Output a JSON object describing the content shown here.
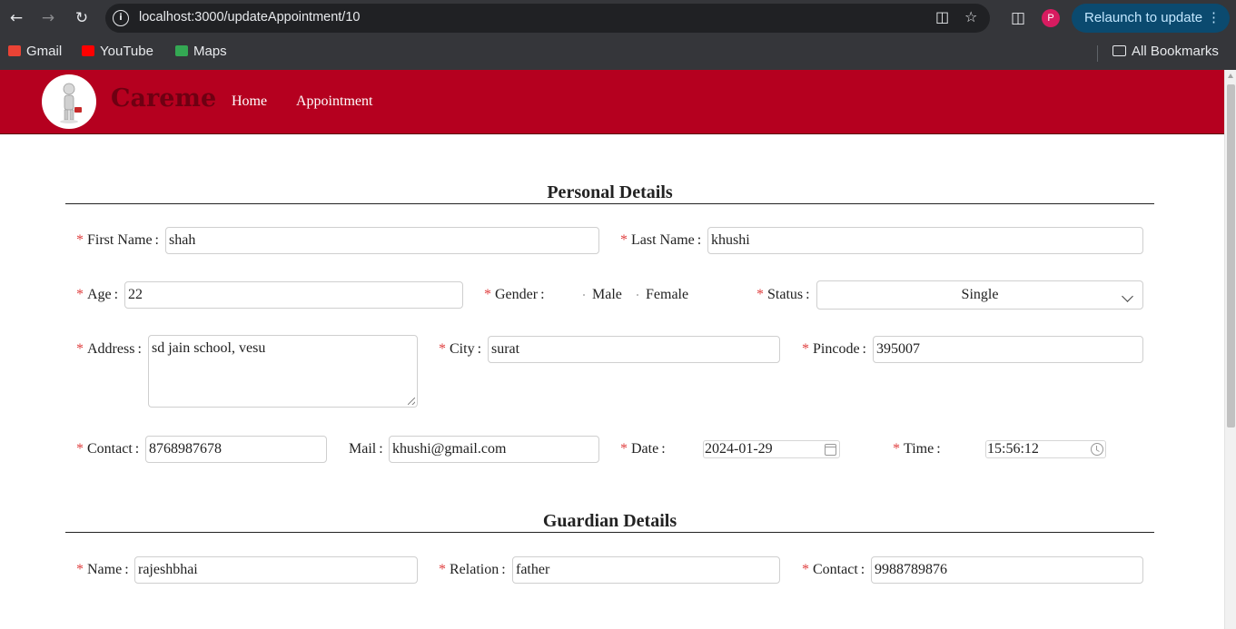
{
  "browser": {
    "url": "localhost:3000/updateAppointment/10",
    "relaunch_label": "Relaunch to update",
    "profile_initial": "P",
    "bookmarks": [
      {
        "label": "Gmail",
        "icon": "gmail-icon",
        "color": "#ea4335"
      },
      {
        "label": "YouTube",
        "icon": "youtube-icon",
        "color": "#ff0000"
      },
      {
        "label": "Maps",
        "icon": "maps-icon",
        "color": "#34a853"
      }
    ],
    "all_bookmarks_label": "All Bookmarks"
  },
  "header": {
    "brand": "Careme",
    "nav": [
      "Home",
      "Appointment"
    ],
    "background_color": "#b5001f"
  },
  "personal": {
    "title": "Personal Details",
    "first_name": {
      "label": "First Name",
      "value": "shah"
    },
    "last_name": {
      "label": "Last Name",
      "value": "khushi"
    },
    "age": {
      "label": "Age",
      "value": "22"
    },
    "gender": {
      "label": "Gender",
      "options": [
        "Male",
        "Female"
      ]
    },
    "status": {
      "label": "Status",
      "value": "Single"
    },
    "address": {
      "label": "Address",
      "value": "sd jain school, vesu"
    },
    "city": {
      "label": "City",
      "value": "surat"
    },
    "pincode": {
      "label": "Pincode",
      "value": "395007"
    },
    "contact": {
      "label": "Contact",
      "value": "8768987678"
    },
    "mail": {
      "label": "Mail",
      "value": "khushi@gmail.com"
    },
    "date": {
      "label": "Date",
      "value": "2024-01-29"
    },
    "time": {
      "label": "Time",
      "value": "15:56:12"
    }
  },
  "guardian": {
    "title": "Guardian Details",
    "name": {
      "label": "Name",
      "value": "rajeshbhai"
    },
    "relation": {
      "label": "Relation",
      "value": "father"
    },
    "contact": {
      "label": "Contact",
      "value": "9988789876"
    }
  },
  "required_marker": "*",
  "colon": ":"
}
